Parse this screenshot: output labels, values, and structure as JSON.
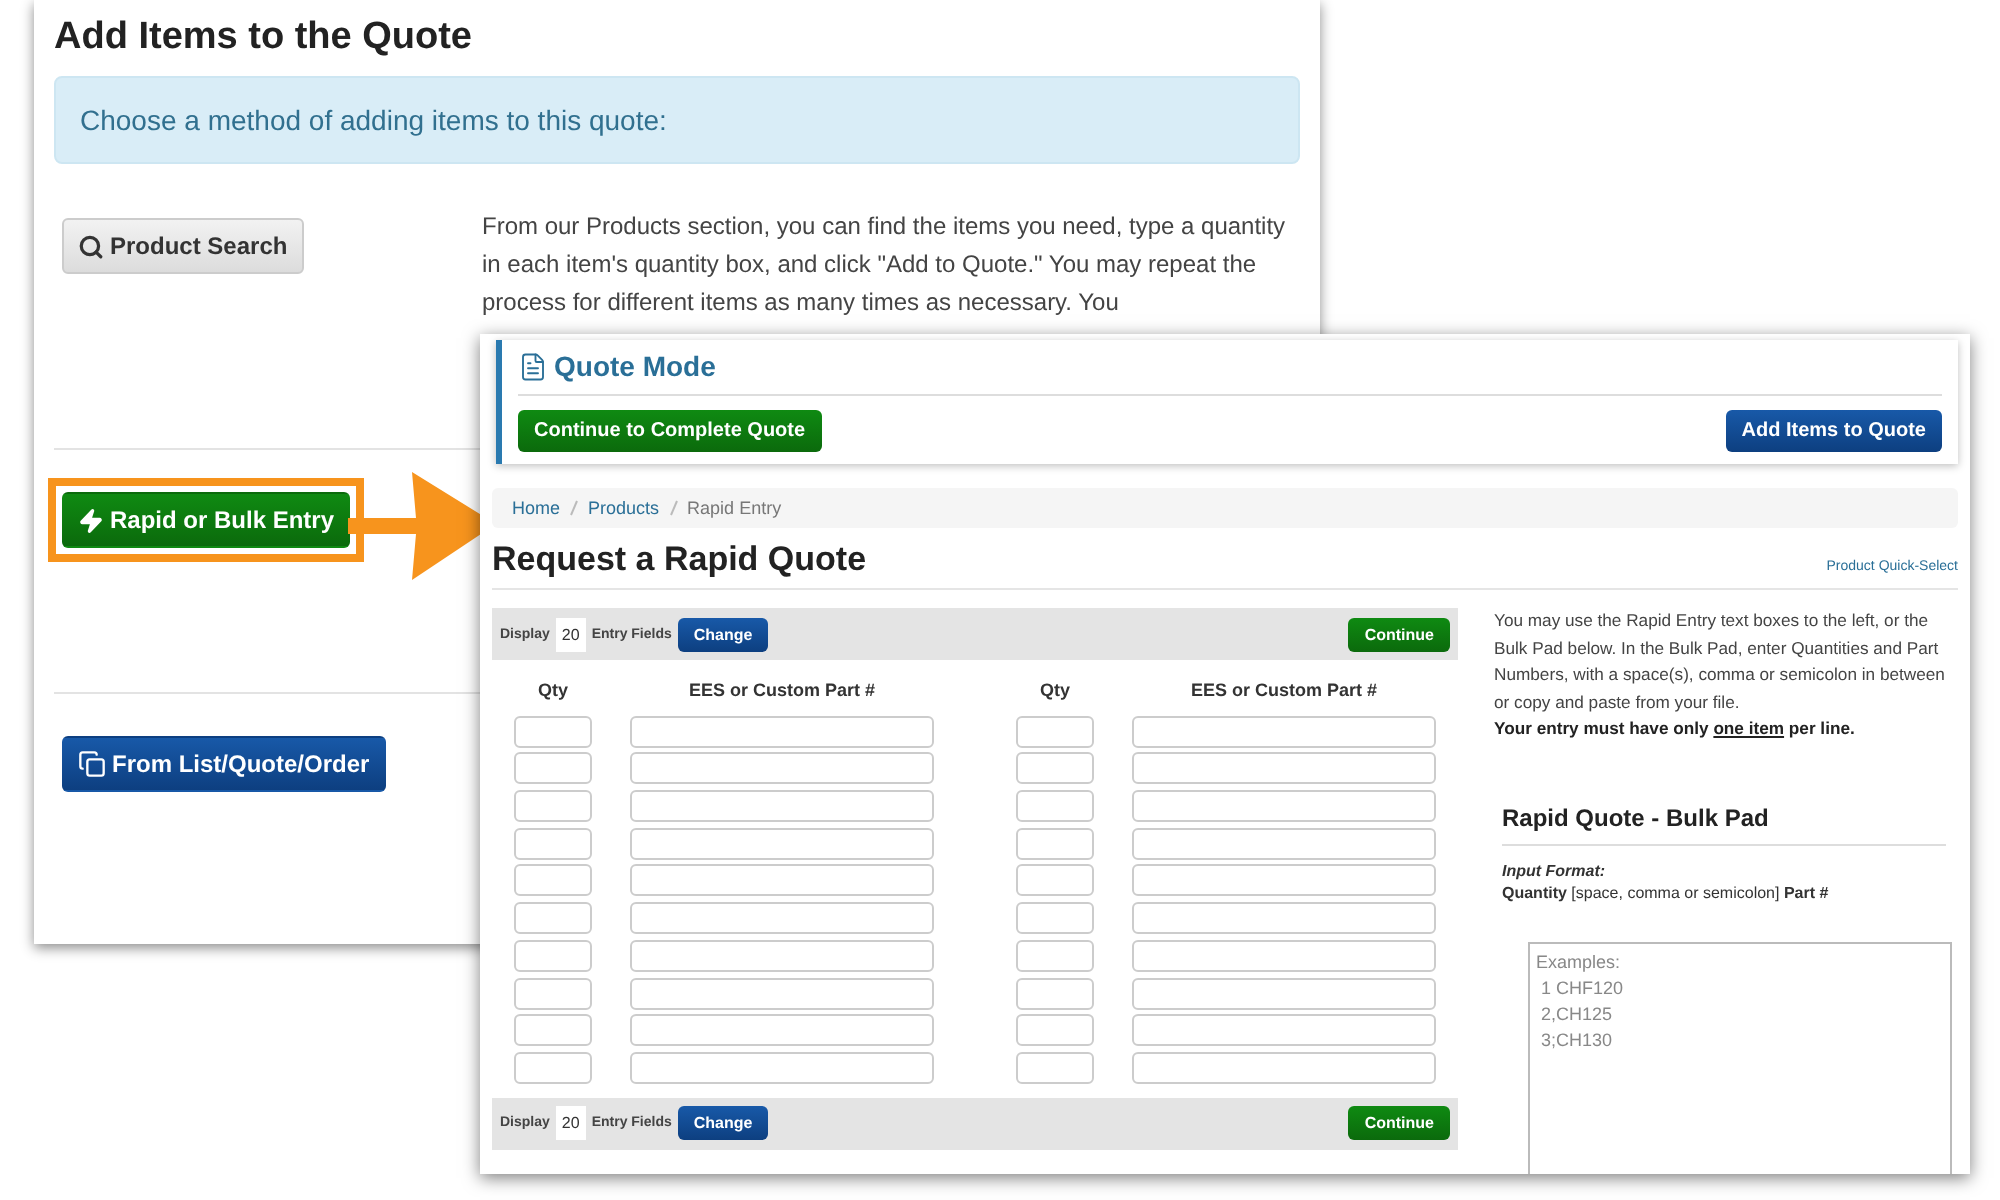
{
  "back_window": {
    "title": "Add Items to the Quote",
    "notice": "Choose a method of adding items to this quote:",
    "methods": [
      {
        "kind": "search",
        "label": "Product Search",
        "highlighted": false
      },
      {
        "kind": "rapid",
        "label": "Rapid or Bulk Entry",
        "highlighted": true
      },
      {
        "kind": "list",
        "label": "From List/Quote/Order",
        "highlighted": false
      }
    ],
    "description": "From our Products section, you can find the items you need, type a quantity in each item's quantity box, and click \"Add to Quote.\" You may repeat the process for different items as many times as necessary. You"
  },
  "front_window": {
    "quote_mode": {
      "title": "Quote Mode",
      "continue_button": "Continue to Complete Quote",
      "add_button": "Add Items to Quote"
    },
    "breadcrumb": [
      {
        "label": "Home",
        "current": false
      },
      {
        "label": "Products",
        "current": false
      },
      {
        "label": "Rapid Entry",
        "current": true
      }
    ],
    "page_title": "Request a Rapid Quote",
    "quick_select_link": "Product Quick-Select",
    "toolbars": [
      {
        "display_label": "Display",
        "count": "20",
        "fields_label": "Entry Fields",
        "change_button": "Change",
        "continue_button": "Continue"
      },
      {
        "display_label": "Display",
        "count": "20",
        "fields_label": "Entry Fields",
        "change_button": "Change",
        "continue_button": "Continue"
      }
    ],
    "entry_columns": [
      {
        "qty_header": "Qty",
        "part_header": "EES or Custom Part #"
      },
      {
        "qty_header": "Qty",
        "part_header": "EES or Custom Part #"
      }
    ],
    "entry_rows": [
      {
        "kind": "entry"
      },
      {
        "kind": "entry"
      },
      {
        "kind": "entry"
      },
      {
        "kind": "entry"
      },
      {
        "kind": "entry"
      },
      {
        "kind": "entry"
      },
      {
        "kind": "entry"
      },
      {
        "kind": "entry"
      },
      {
        "kind": "entry"
      },
      {
        "kind": "entry"
      }
    ],
    "help_text": "You may use the Rapid Entry text boxes to the left, or the Bulk Pad below. In the Bulk Pad, enter Quantities and Part Numbers, with a space(s), comma or semicolon in between or copy and paste from your file.",
    "rule_note": {
      "before": "Your entry must have only",
      "underlined": "one item",
      "after": "per line."
    },
    "bulk_pad": {
      "title": "Rapid Quote - Bulk Pad",
      "format_label": "Input Format:",
      "format": "**Quantity** [space, comma or semicolon] **Part #**",
      "placeholder": "Examples:\n 1 CHF120\n 2,CH125\n 3;CH130"
    }
  }
}
